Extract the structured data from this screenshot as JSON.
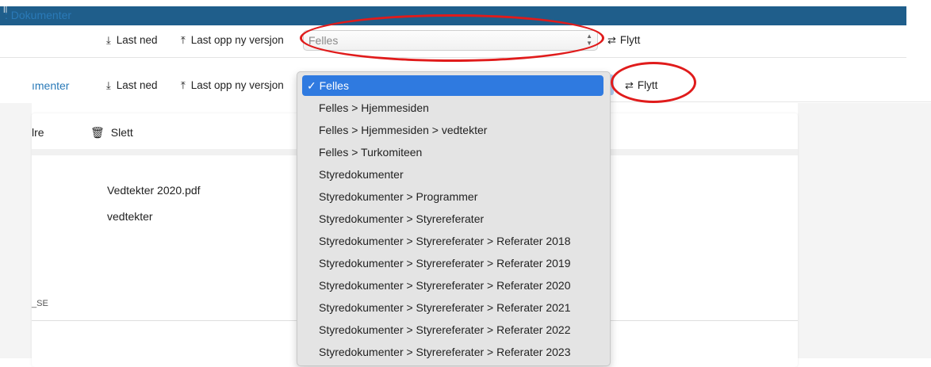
{
  "topbar": {
    "mark": "||"
  },
  "toolbar1": {
    "breadcrumb": ": Dokumenter",
    "download_label": "Last ned",
    "upload_label": "Last opp ny versjon",
    "folder_select_value": "Felles",
    "move_label": "Flytt"
  },
  "toolbar2": {
    "breadcrumb": "ımenter",
    "download_label": "Last ned",
    "upload_label": "Last opp ny versjon",
    "move_label": "Flytt"
  },
  "card": {
    "edit_label_partial": "lre",
    "delete_label": "Slett",
    "filename": "Vedtekter 2020.pdf",
    "folder": "vedtekter",
    "partial_text": "_SE"
  },
  "dropdown": {
    "options": [
      "✓ Felles",
      "Felles > Hjemmesiden",
      "Felles > Hjemmesiden > vedtekter",
      "Felles > Turkomiteen",
      "Styredokumenter",
      "Styredokumenter > Programmer",
      "Styredokumenter > Styrereferater",
      "Styredokumenter > Styrereferater > Referater 2018",
      "Styredokumenter > Styrereferater > Referater 2019",
      "Styredokumenter > Styrereferater > Referater 2020",
      "Styredokumenter > Styrereferater > Referater 2021",
      "Styredokumenter > Styrereferater > Referater 2022",
      "Styredokumenter > Styrereferater > Referater 2023"
    ],
    "selected_index": 0
  },
  "colors": {
    "topbar": "#1f5e8b",
    "link": "#2a7ab8",
    "selection": "#2f7ae0",
    "annotation": "#e01b1b"
  },
  "icons": {
    "download": "download-icon",
    "upload": "upload-icon",
    "move": "swap-arrows-icon",
    "delete": "trash-icon",
    "select_arrows": "select-arrows-icon"
  }
}
